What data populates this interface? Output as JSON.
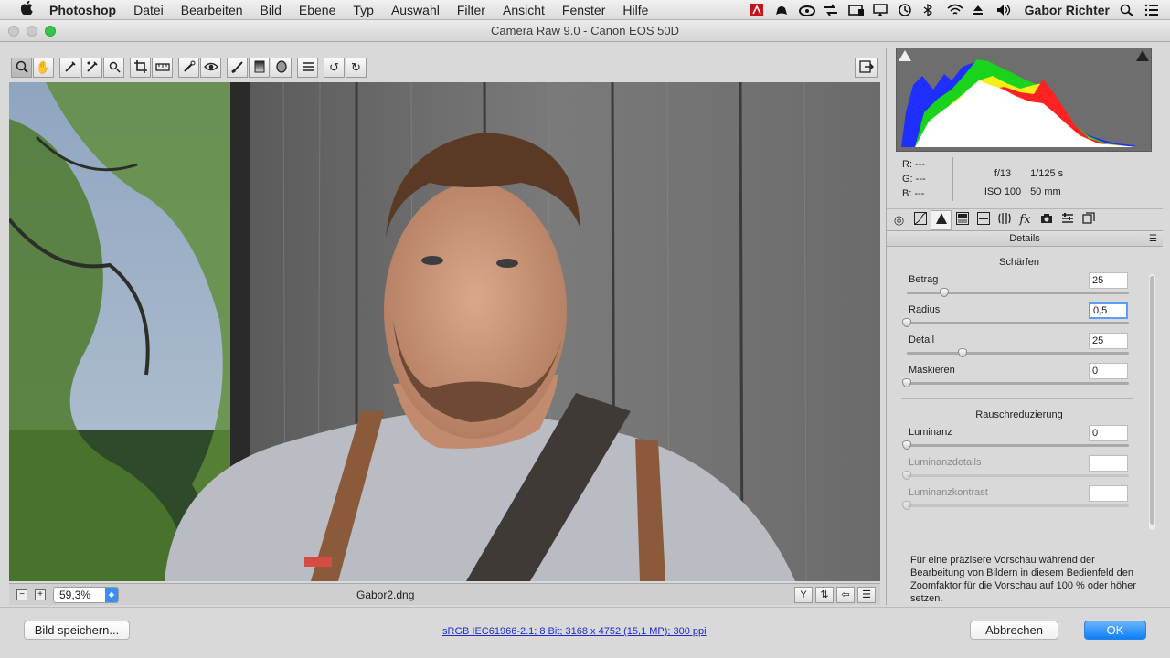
{
  "menubar": {
    "apple": "",
    "items": [
      "Photoshop",
      "Datei",
      "Bearbeiten",
      "Bild",
      "Ebene",
      "Typ",
      "Auswahl",
      "Filter",
      "Ansicht",
      "Fenster",
      "Hilfe"
    ],
    "user": "Gabor Richter",
    "tray_icons": [
      "adobe-icon",
      "hat-icon",
      "creative-cloud-icon",
      "arrows-icon",
      "backup-icon",
      "airplay-icon",
      "time-machine-icon",
      "bluetooth-icon",
      "wifi-icon",
      "eject-icon",
      "volume-icon"
    ]
  },
  "window": {
    "title": "Camera Raw 9.0 - Canon EOS 50D"
  },
  "toolbar": {
    "tools": [
      "zoom-icon",
      "hand-icon",
      "white-balance-icon",
      "color-sampler-icon",
      "target-adjust-icon",
      "crop-icon",
      "straighten-icon",
      "spot-removal-icon",
      "red-eye-icon",
      "adjustment-brush-icon",
      "graduated-filter-icon",
      "radial-filter-icon",
      "preferences-icon",
      "rotate-left-icon",
      "rotate-right-icon"
    ]
  },
  "preview": {
    "zoom_minus": "−",
    "zoom_plus": "+",
    "zoom_value": "59,3%",
    "filename": "Gabor2.dng"
  },
  "readout": {
    "r": "R:  ---",
    "g": "G:  ---",
    "b": "B:  ---",
    "aperture": "f/13",
    "shutter": "1/125 s",
    "iso": "ISO 100",
    "focal": "50 mm"
  },
  "panel": {
    "section_title": "Details",
    "sharpen": {
      "title": "Schärfen",
      "sliders": [
        {
          "label": "Betrag",
          "value": "25",
          "fraction": 0.17
        },
        {
          "label": "Radius",
          "value": "0,5",
          "fraction": 0.0
        },
        {
          "label": "Detail",
          "value": "25",
          "fraction": 0.25
        },
        {
          "label": "Maskieren",
          "value": "0",
          "fraction": 0.0
        }
      ]
    },
    "noise": {
      "title": "Rauschreduzierung",
      "sliders": [
        {
          "label": "Luminanz",
          "value": "0",
          "fraction": 0.0
        },
        {
          "label": "Luminanzdetails",
          "value": "",
          "fraction": 0.0
        },
        {
          "label": "Luminanzkontrast",
          "value": "",
          "fraction": 0.0
        }
      ]
    },
    "hint": "Für eine präzisere Vorschau während der Bearbeitung von Bildern in diesem Bedienfeld den Zoomfaktor für die Vorschau auf 100 % oder höher setzen."
  },
  "bottom": {
    "save_label": "Bild speichern...",
    "workflow": "sRGB IEC61966-2.1; 8 Bit; 3168 x 4752 (15,1 MP); 300 ppi",
    "cancel_label": "Abbrechen",
    "ok_label": "OK"
  },
  "colors": {
    "accent": "#0d7ffb",
    "link": "#1d2bd0"
  }
}
